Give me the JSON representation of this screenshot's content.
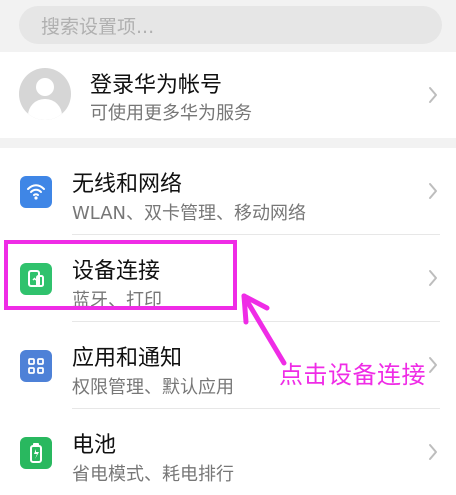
{
  "search": {
    "placeholder": "搜索设置项..."
  },
  "account": {
    "title": "登录华为帐号",
    "subtitle": "可使用更多华为服务",
    "icon": "avatar-icon"
  },
  "settings": {
    "items": [
      {
        "title": "无线和网络",
        "subtitle": "WLAN、双卡管理、移动网络",
        "icon": "wifi-icon",
        "color": "#3f86e6"
      },
      {
        "title": "设备连接",
        "subtitle": "蓝牙、打印",
        "icon": "device-connection-icon",
        "color": "#30c26d"
      },
      {
        "title": "应用和通知",
        "subtitle": "权限管理、默认应用",
        "icon": "apps-grid-icon",
        "color": "#4e81d7"
      },
      {
        "title": "电池",
        "subtitle": "省电模式、耗电排行",
        "icon": "battery-icon",
        "color": "#29b85f"
      }
    ]
  },
  "annotation": {
    "text": "点击设备连接",
    "color": "#ef2ce6"
  }
}
